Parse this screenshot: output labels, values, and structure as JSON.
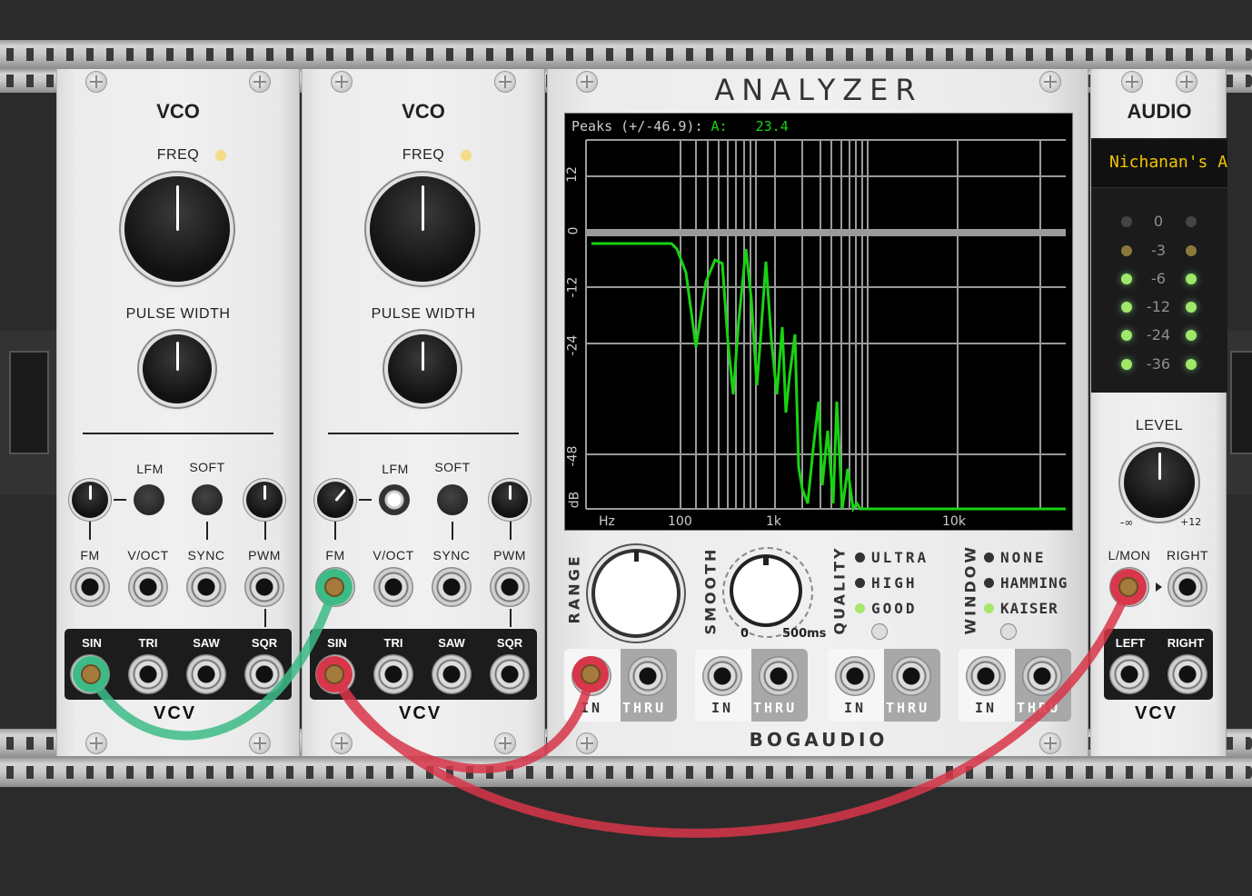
{
  "vco1": {
    "title": "VCO",
    "freq_label": "FREQ",
    "pw_label": "PULSE WIDTH",
    "lfm_label": "LFM",
    "soft_label": "SOFT",
    "inputs": [
      "FM",
      "V/OCT",
      "SYNC",
      "PWM"
    ],
    "outputs": [
      "SIN",
      "TRI",
      "SAW",
      "SQR"
    ],
    "brand": "VCV"
  },
  "vco2": {
    "title": "VCO",
    "freq_label": "FREQ",
    "pw_label": "PULSE WIDTH",
    "lfm_label": "LFM",
    "soft_label": "SOFT",
    "inputs": [
      "FM",
      "V/OCT",
      "SYNC",
      "PWM"
    ],
    "outputs": [
      "SIN",
      "TRI",
      "SAW",
      "SQR"
    ],
    "brand": "VCV"
  },
  "analyzer": {
    "title": "ANALYZER",
    "peaks_text": "Peaks (+/-46.9):",
    "channel": "A:",
    "peak_value": "23.4",
    "y_ticks": [
      "12",
      "0",
      "-12",
      "-24",
      "-48",
      "dB"
    ],
    "x_ticks": [
      "Hz",
      "100",
      "1k",
      "10k"
    ],
    "range_label": "RANGE",
    "smooth_label": "SMOOTH",
    "smooth_min": "0",
    "smooth_max": "500ms",
    "quality_label": "QUALITY",
    "quality_options": [
      "ULTRA",
      "HIGH",
      "GOOD"
    ],
    "quality_selected": "GOOD",
    "window_label": "WINDOW",
    "window_options": [
      "NONE",
      "HAMMING",
      "KAISER"
    ],
    "window_selected": "KAISER",
    "port_in": "IN",
    "port_thru": "THRU",
    "brand": "BOGAUDIO"
  },
  "audio": {
    "title": "AUDIO",
    "device": "Nichanan's A",
    "meter": [
      "0",
      "-3",
      "-6",
      "-12",
      "-24",
      "-36"
    ],
    "level_label": "LEVEL",
    "level_min": "-∞",
    "level_max": "+12",
    "lmon_label": "L/MON",
    "right_label": "RIGHT",
    "left_label": "LEFT",
    "right_out_label": "RIGHT",
    "brand": "VCV"
  },
  "colors": {
    "cable_green": "#3dbb86",
    "cable_red": "#d8364a",
    "trace_green": "#19d313",
    "device_text": "#f2c500"
  }
}
